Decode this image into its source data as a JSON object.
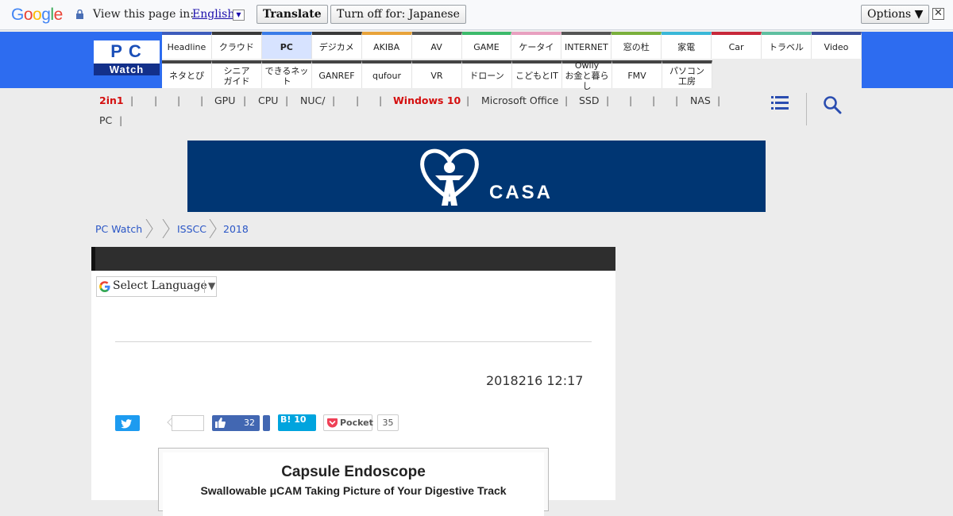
{
  "translate_bar": {
    "prompt": "View this page in:",
    "language": "English",
    "translate_label": "Translate",
    "turn_off_label": "Turn off for: Japanese",
    "options_label": "Options ▼",
    "close": "✕"
  },
  "header": {
    "logo_top": "PC",
    "logo_bottom": "Watch",
    "nav_row1": [
      {
        "label": "Headline",
        "color": "#3d5cbc"
      },
      {
        "label": "クラウド",
        "color": "#3a3a3a"
      },
      {
        "label": "PC",
        "color": "#3a7ce8",
        "active": true
      },
      {
        "label": "デジカメ",
        "color": "#3a3a3a"
      },
      {
        "label": "AKIBA",
        "color": "#e8a33a"
      },
      {
        "label": "AV",
        "color": "#555"
      },
      {
        "label": "GAME",
        "color": "#3cba6b"
      },
      {
        "label": "ケータイ",
        "color": "#e8a0c0"
      },
      {
        "label": "INTERNET",
        "color": "#555"
      },
      {
        "label": "窓の杜",
        "color": "#7ab03c"
      },
      {
        "label": "家電",
        "color": "#3ab8d8"
      },
      {
        "label": "Car",
        "color": "#c8283a"
      },
      {
        "label": "トラベル",
        "color": "#5fbfa0"
      },
      {
        "label": "Video",
        "color": "#3a4e9a"
      }
    ],
    "nav_row2": [
      {
        "label": "ネタとぴ"
      },
      {
        "label": "シニア\nガイド"
      },
      {
        "label": "できるネット"
      },
      {
        "label": "GANREF"
      },
      {
        "label": "qufour"
      },
      {
        "label": "VR"
      },
      {
        "label": "ドローン"
      },
      {
        "label": "こどもとIT"
      },
      {
        "label": "Owlly\nお金と暮らし"
      },
      {
        "label": "FMV"
      },
      {
        "label": "パソコン\n工房"
      }
    ]
  },
  "keywords": {
    "k1": "2in1",
    "k2": "GPU",
    "k3": "CPU",
    "k4": "NUC/",
    "k5": "Windows 10",
    "k6": "Microsoft Office",
    "k7": "SSD",
    "k8": "NAS",
    "k9": "PC",
    "sep": "|"
  },
  "banner": {
    "text": "CASA",
    "mark": "®"
  },
  "breadcrumb": {
    "b1": "PC Watch",
    "b2": "ISSCC",
    "b3": "2018"
  },
  "article": {
    "select_language": "Select Language",
    "date": "2018216 12:17",
    "fb_count": "32",
    "hatena": "B! 10",
    "pocket_label": "Pocket",
    "pocket_count": "35",
    "figure_title": "Capsule Endoscope",
    "figure_subtitle": "Swallowable μCAM Taking Picture of Your Digestive Track"
  },
  "colors": {
    "header_blue": "#2d6cf0",
    "banner_navy": "#003673",
    "keyword_red": "#d40f0f"
  }
}
